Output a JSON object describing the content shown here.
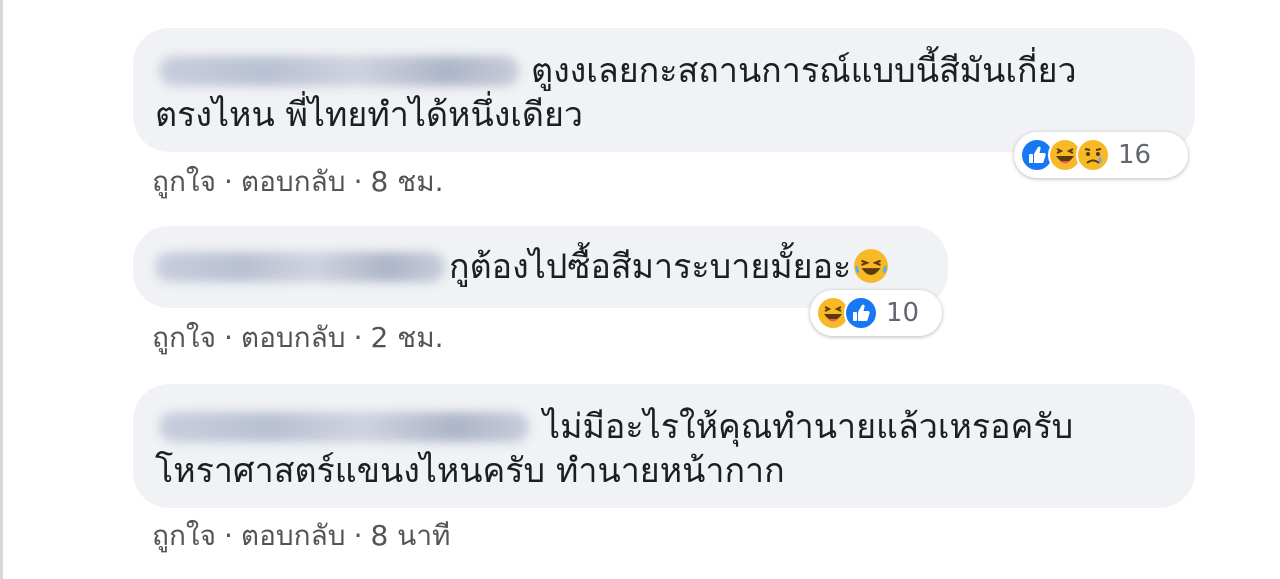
{
  "comments": [
    {
      "text_line1": "ตูงงเลยกะสถานการณ์แบบนี้สีมันเกี่ยว",
      "text_line2": "ตรงไหน พี่ไทยทำได้หนึ่งเดียว",
      "actions": {
        "like": "ถูกใจ",
        "reply": "ตอบกลับ",
        "time": "8 ชม."
      },
      "reactions": {
        "icons": [
          "like-icon",
          "haha-icon",
          "sad-icon"
        ],
        "count": "16"
      }
    },
    {
      "text_line1": "กูต้องไปซื้อสีมาระบายมั้ยอะ",
      "actions": {
        "like": "ถูกใจ",
        "reply": "ตอบกลับ",
        "time": "2 ชม."
      },
      "reactions": {
        "icons": [
          "haha-icon",
          "like-icon"
        ],
        "count": "10"
      }
    },
    {
      "text_line1": "ไม่มีอะไรให้คุณทำนายแล้วเหรอครับ",
      "text_line2": "โหราศาสตร์แขนงไหนครับ ทำนายหน้ากาก",
      "actions": {
        "like": "ถูกใจ",
        "reply": "ตอบกลับ",
        "time": "8 นาที"
      }
    }
  ],
  "colors": {
    "bubble": "#f0f2f5",
    "text": "#1c1e21",
    "meta": "#545454",
    "like_blue": "#1877f2",
    "emoji_yellow": "#f7b928"
  }
}
